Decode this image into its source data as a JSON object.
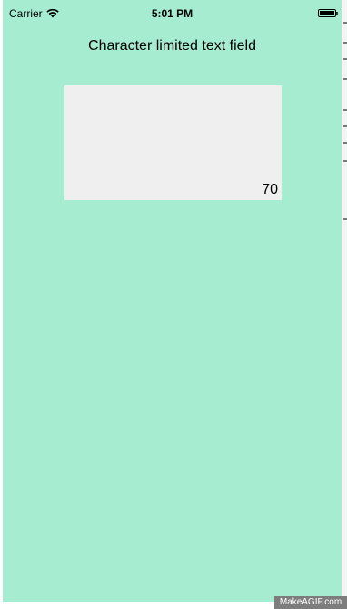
{
  "status_bar": {
    "carrier": "Carrier",
    "time": "5:01 PM"
  },
  "screen": {
    "title": "Character limited text field",
    "text_field_value": "",
    "counter": "70",
    "background_color": "#a5ecd1",
    "field_color": "#efefef"
  },
  "watermark": "MakeAGIF.com"
}
